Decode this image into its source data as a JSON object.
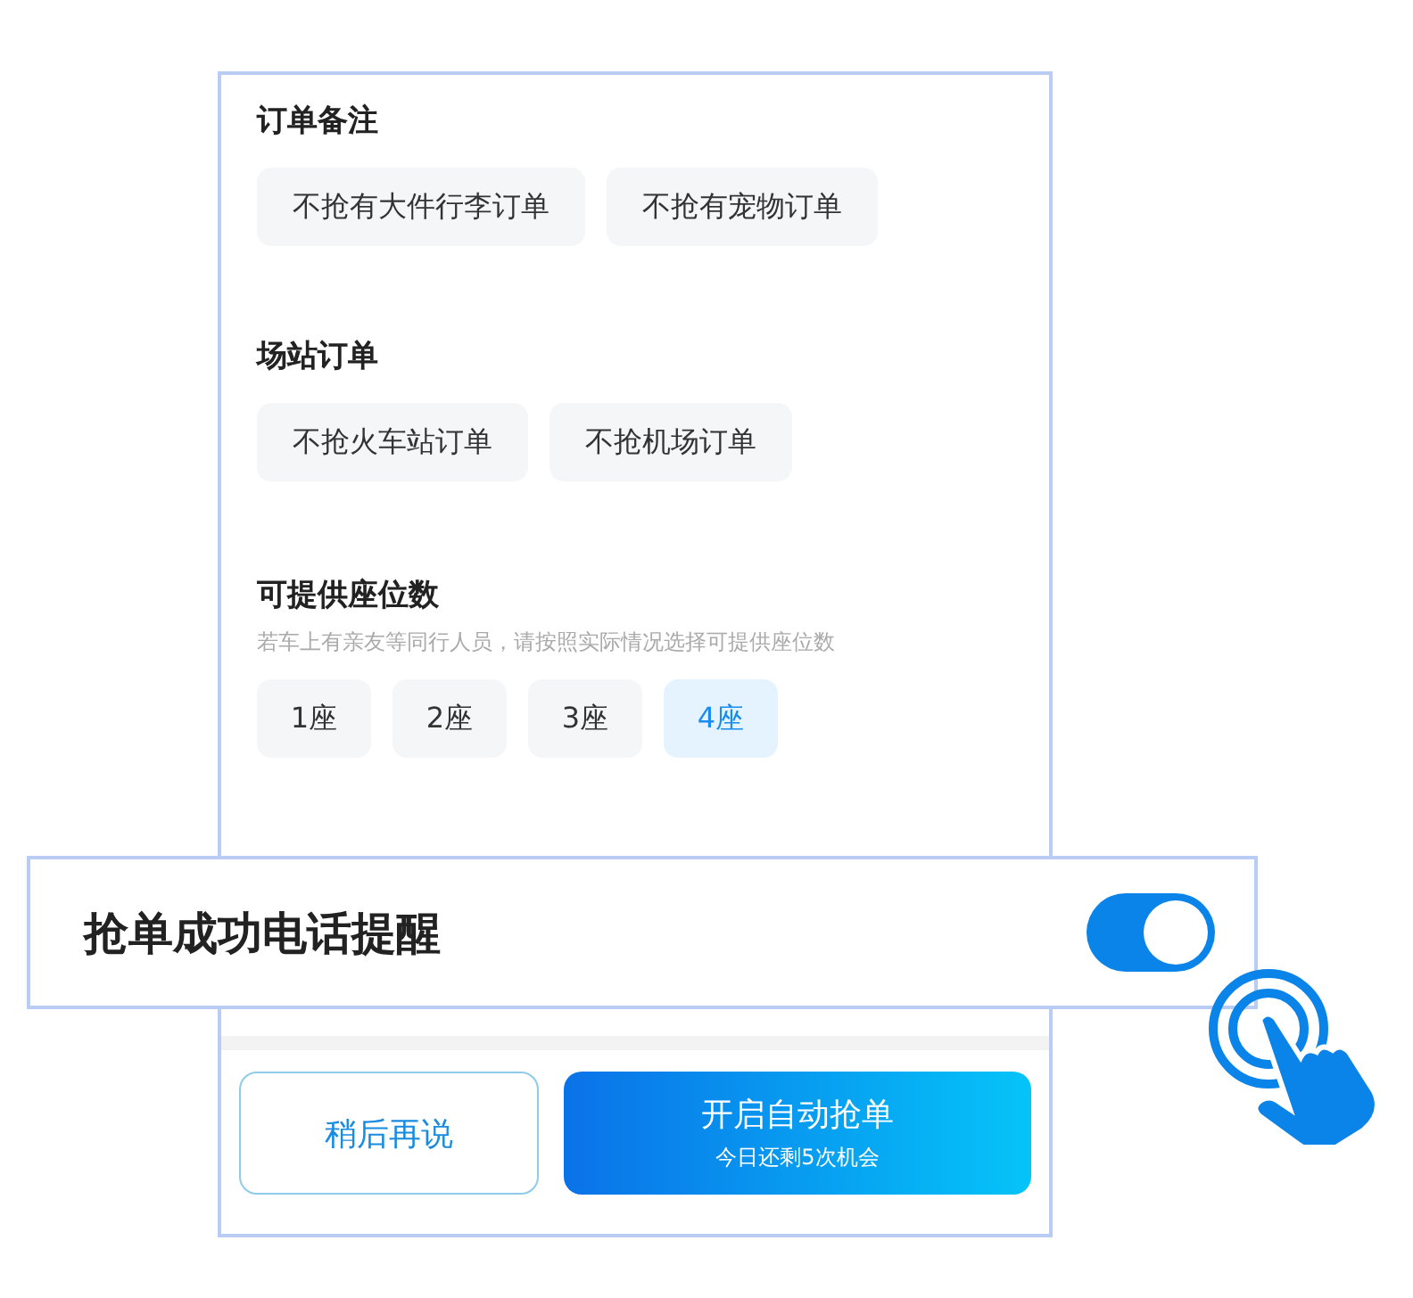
{
  "sections": [
    {
      "title": "订单备注",
      "options": [
        {
          "label": "不抢有大件行李订单",
          "selected": false
        },
        {
          "label": "不抢有宠物订单",
          "selected": false
        }
      ]
    },
    {
      "title": "场站订单",
      "options": [
        {
          "label": "不抢火车站订单",
          "selected": false
        },
        {
          "label": "不抢机场订单",
          "selected": false
        }
      ]
    },
    {
      "title": "可提供座位数",
      "hint": "若车上有亲友等同行人员，请按照实际情况选择可提供座位数",
      "options": [
        {
          "label": "1座",
          "selected": false
        },
        {
          "label": "2座",
          "selected": false
        },
        {
          "label": "3座",
          "selected": false
        },
        {
          "label": "4座",
          "selected": true
        }
      ]
    }
  ],
  "call_reminder": {
    "label": "抢单成功电话提醒",
    "on": true
  },
  "buttons": {
    "later": "稍后再说",
    "start": {
      "label": "开启自动抢单",
      "sub": "今日还剩5次机会"
    }
  }
}
